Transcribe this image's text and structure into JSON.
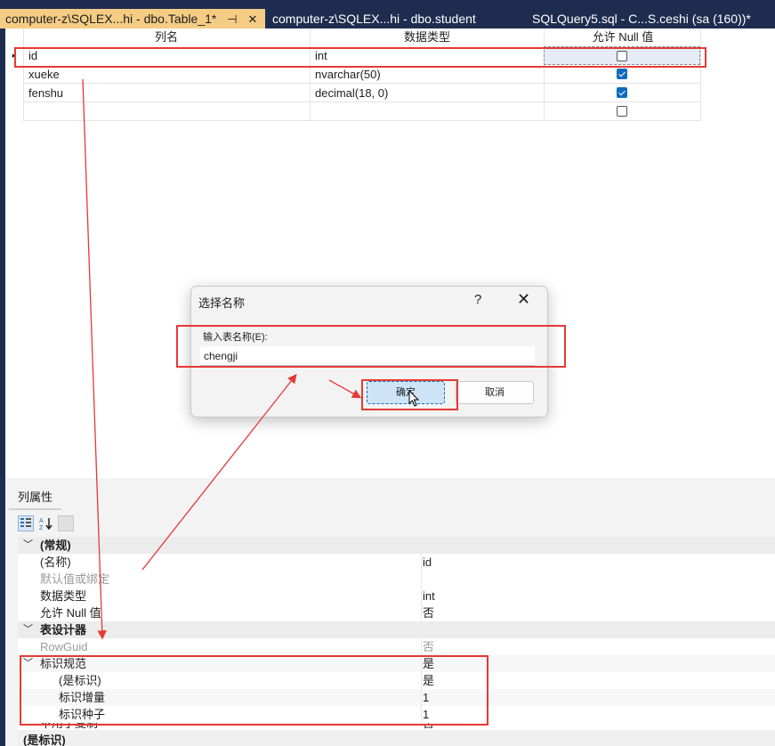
{
  "tabs": [
    {
      "label": "computer-z\\SQLEX...hi - dbo.Table_1*",
      "active": true,
      "pin": "⊣",
      "close": "✕"
    },
    {
      "label": "computer-z\\SQLEX...hi - dbo.student",
      "active": false
    },
    {
      "label": "SQLQuery5.sql - C...S.ceshi (sa (160))*",
      "active": false
    }
  ],
  "grid": {
    "headers": [
      "列名",
      "数据类型",
      "允许 Null 值"
    ],
    "rows": [
      {
        "name": "id",
        "type": "int",
        "allow_null": false,
        "selected": true
      },
      {
        "name": "xueke",
        "type": "nvarchar(50)",
        "allow_null": true
      },
      {
        "name": "fenshu",
        "type": "decimal(18, 0)",
        "allow_null": true
      },
      {
        "name": "",
        "type": "",
        "allow_null": false
      }
    ],
    "row_marker": "▸"
  },
  "dialog": {
    "title": "选择名称",
    "help": "?",
    "close": "✕",
    "input_label": "输入表名称(E):",
    "input_value": "chengji",
    "ok_label": "确定",
    "cancel_label": "取消"
  },
  "properties": {
    "tab_label": "列属性",
    "toolbar_icons": [
      "categorized-icon",
      "alphabetical-icon",
      "property-pages-icon"
    ],
    "rows": [
      {
        "kind": "category",
        "name": "(常规)",
        "value": ""
      },
      {
        "kind": "item",
        "name": "(名称)",
        "value": "id"
      },
      {
        "kind": "disabled",
        "name": "默认值或绑定",
        "value": ""
      },
      {
        "kind": "item",
        "name": "数据类型",
        "value": "int"
      },
      {
        "kind": "item",
        "name": "允许 Null 值",
        "value": "否"
      },
      {
        "kind": "category",
        "name": "表设计器",
        "value": ""
      },
      {
        "kind": "disabled",
        "name": "RowGuid",
        "value": "否"
      },
      {
        "kind": "expand",
        "name": "标识规范",
        "value": "是"
      },
      {
        "kind": "sub",
        "name": "(是标识)",
        "value": "是"
      },
      {
        "kind": "sub",
        "name": "标识增量",
        "value": "1"
      },
      {
        "kind": "sub",
        "name": "标识种子",
        "value": "1"
      },
      {
        "kind": "item",
        "name": "不用于复制",
        "value": "否"
      }
    ],
    "footer_label": "(是标识)"
  },
  "colors": {
    "accent": "#0f6cbd",
    "annotation_red": "#e53935",
    "active_tab": "#f5cc84",
    "chrome": "#1e2d4f"
  }
}
